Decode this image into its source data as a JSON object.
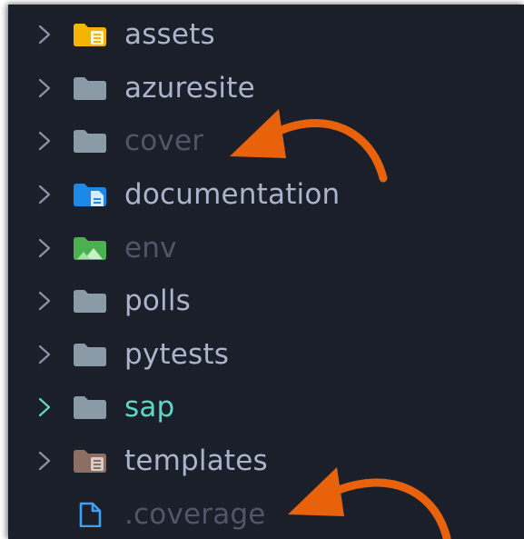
{
  "colors": {
    "background": "#1b1f2a",
    "text_normal": "#aab4cc",
    "text_dim": "#4f5668",
    "text_highlight": "#5fd7c7",
    "chevron_normal": "#8a93a8",
    "chevron_highlight": "#5fd7c7",
    "folder_gray": "#8a9aa6",
    "folder_yellow": "#f4b400",
    "folder_blue": "#1e88e5",
    "folder_green": "#4caf50",
    "folder_brown": "#8d6e63",
    "file_blue": "#3ea1f2",
    "arrow_orange": "#e8620c"
  },
  "explorer": {
    "items": [
      {
        "label": "assets",
        "icon": "folder-assets-icon",
        "style": "normal",
        "has_chevron": true
      },
      {
        "label": "azuresite",
        "icon": "folder-icon",
        "style": "normal",
        "has_chevron": true
      },
      {
        "label": "cover",
        "icon": "folder-icon",
        "style": "dim",
        "has_chevron": true
      },
      {
        "label": "documentation",
        "icon": "folder-docs-icon",
        "style": "normal",
        "has_chevron": true
      },
      {
        "label": "env",
        "icon": "folder-env-icon",
        "style": "dim",
        "has_chevron": true
      },
      {
        "label": "polls",
        "icon": "folder-icon",
        "style": "normal",
        "has_chevron": true
      },
      {
        "label": "pytests",
        "icon": "folder-icon",
        "style": "normal",
        "has_chevron": true
      },
      {
        "label": "sap",
        "icon": "folder-icon",
        "style": "highlight",
        "has_chevron": true
      },
      {
        "label": "templates",
        "icon": "folder-templates-icon",
        "style": "normal",
        "has_chevron": true
      },
      {
        "label": ".coverage",
        "icon": "file-icon",
        "style": "dim",
        "has_chevron": false
      }
    ]
  },
  "annotations": [
    {
      "name": "arrow-pointing-to-cover",
      "target": "cover",
      "color": "#e8620c"
    },
    {
      "name": "arrow-pointing-to-coverage",
      "target": ".coverage",
      "color": "#e8620c"
    }
  ]
}
